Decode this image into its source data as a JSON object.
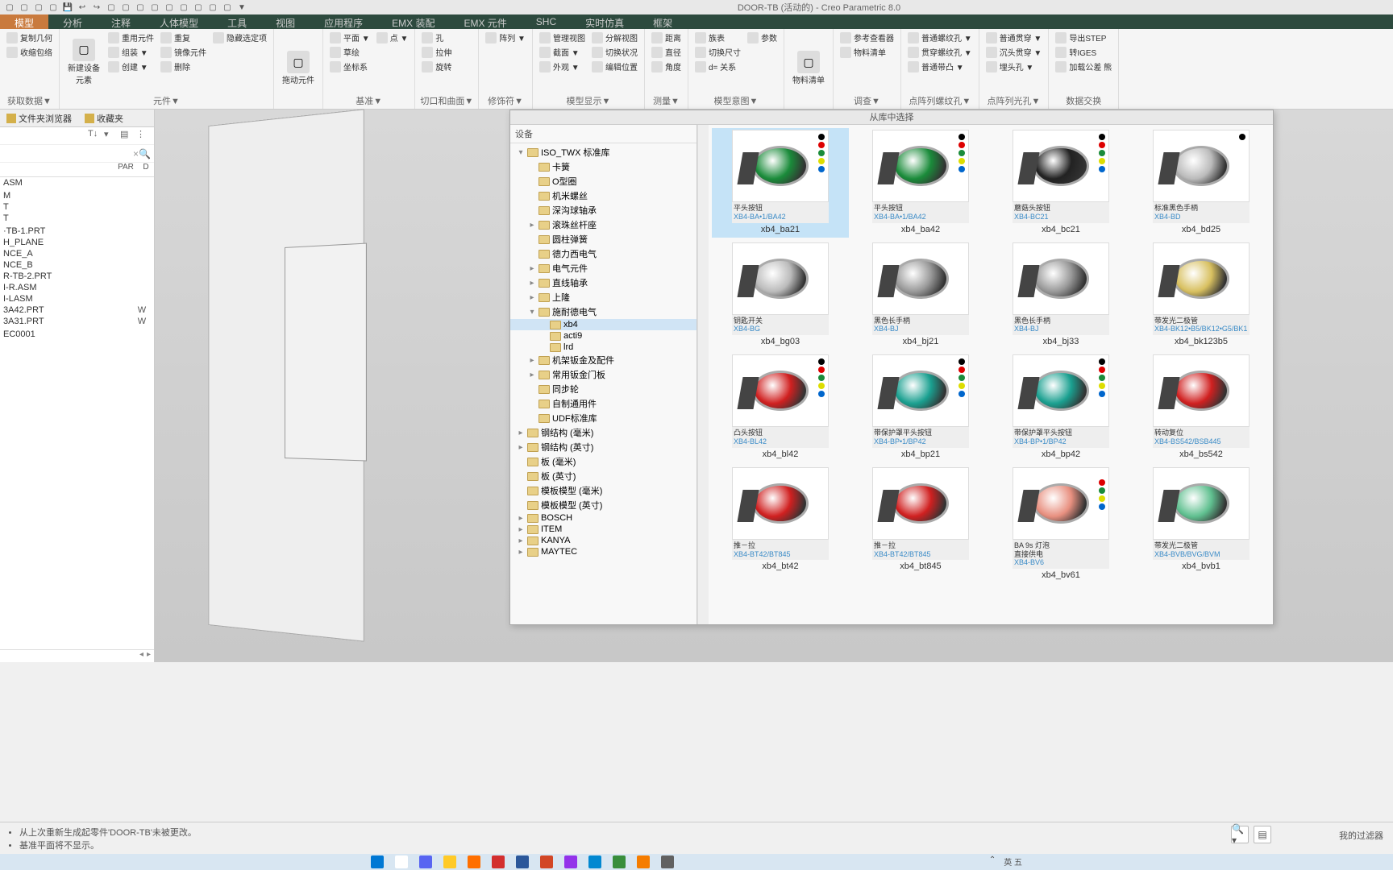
{
  "title": "DOOR-TB (活动的) - Creo Parametric 8.0",
  "tabs": [
    "模型",
    "分析",
    "注释",
    "人体模型",
    "工具",
    "视图",
    "应用程序",
    "EMX 装配",
    "EMX 元件",
    "SHC",
    "实时仿真",
    "框架"
  ],
  "activeTab": 0,
  "ribbon": {
    "groups": [
      {
        "label": "获取数据▼",
        "items": [
          {
            "t": "复制几何"
          },
          {
            "t": "收缩包络"
          }
        ]
      },
      {
        "label": "元件▼",
        "items": [
          {
            "t": "重用元件"
          },
          {
            "t": "组装 ▼"
          },
          {
            "t": "创建 ▼"
          },
          {
            "t": "重复"
          },
          {
            "t": "镜像元件"
          },
          {
            "t": "新建设备\n元素",
            "big": true
          },
          {
            "t": "删除"
          },
          {
            "t": "隐藏选定项"
          }
        ]
      },
      {
        "label": "",
        "items": [
          {
            "t": "拖动元件",
            "big": true
          }
        ]
      },
      {
        "label": "基准▼",
        "items": [
          {
            "t": "平面 ▼"
          },
          {
            "t": "草绘"
          },
          {
            "t": "坐标系"
          },
          {
            "t": "点 ▼"
          }
        ]
      },
      {
        "label": "切口和曲面▼",
        "items": [
          {
            "t": "孔"
          },
          {
            "t": "拉伸"
          },
          {
            "t": "旋转"
          }
        ]
      },
      {
        "label": "修饰符▼",
        "items": [
          {
            "t": "阵列 ▼"
          }
        ]
      },
      {
        "label": "模型显示▼",
        "items": [
          {
            "t": "管理视图"
          },
          {
            "t": "截面 ▼"
          },
          {
            "t": "外观 ▼"
          },
          {
            "t": "分解视图"
          },
          {
            "t": "切换状况"
          },
          {
            "t": "编辑位置"
          }
        ]
      },
      {
        "label": "测量▼",
        "items": [
          {
            "t": "距离"
          },
          {
            "t": "直径"
          },
          {
            "t": "角度"
          }
        ]
      },
      {
        "label": "模型意图▼",
        "items": [
          {
            "t": "族表"
          },
          {
            "t": "切换尺寸"
          },
          {
            "t": "d= 关系"
          },
          {
            "t": "参数"
          }
        ]
      },
      {
        "label": "",
        "items": [
          {
            "t": "物料清单",
            "big": true
          }
        ]
      },
      {
        "label": "调查▼",
        "items": [
          {
            "t": "参考查看器"
          },
          {
            "t": "物料清单"
          }
        ]
      },
      {
        "label": "点阵列螺纹孔▼",
        "items": [
          {
            "t": "普通螺纹孔 ▼"
          },
          {
            "t": "贯穿螺纹孔 ▼"
          },
          {
            "t": "普通带凸 ▼"
          }
        ]
      },
      {
        "label": "点阵列光孔▼",
        "items": [
          {
            "t": "普通贯穿 ▼"
          },
          {
            "t": "沉头贯穿 ▼"
          },
          {
            "t": "埋头孔 ▼"
          }
        ]
      },
      {
        "label": "数据交换",
        "items": [
          {
            "t": "导出STEP"
          },
          {
            "t": "转IGES"
          },
          {
            "t": "加载公差 熊"
          }
        ]
      }
    ]
  },
  "leftPanel": {
    "tabs": [
      "文件夹浏览器",
      "收藏夹"
    ],
    "headerCols": [
      "",
      "PAR",
      "D"
    ],
    "tree": [
      {
        "t": "ASM"
      },
      {
        "t": ""
      },
      {
        "t": "M"
      },
      {
        "t": "T"
      },
      {
        "t": "T"
      },
      {
        "t": ""
      },
      {
        "t": "·TB-1.PRT"
      },
      {
        "t": "H_PLANE"
      },
      {
        "t": "NCE_A"
      },
      {
        "t": "NCE_B"
      },
      {
        "t": "R-TB-2.PRT"
      },
      {
        "t": "I-R.ASM"
      },
      {
        "t": "I-LASM"
      },
      {
        "t": "3A42.PRT",
        "c2": "W"
      },
      {
        "t": "3A31.PRT",
        "c2": "W"
      },
      {
        "t": ""
      },
      {
        "t": "EC0001"
      }
    ]
  },
  "library": {
    "title": "从库中选择",
    "treeTitle": "设备",
    "tree": [
      {
        "t": "ISO_TWX 标准库",
        "d": 0,
        "e": "▾"
      },
      {
        "t": "卡簧",
        "d": 1
      },
      {
        "t": "O型圈",
        "d": 1
      },
      {
        "t": "机米螺丝",
        "d": 1
      },
      {
        "t": "深沟球轴承",
        "d": 1
      },
      {
        "t": "滚珠丝杆座",
        "d": 1,
        "e": "▸"
      },
      {
        "t": "圆柱弹簧",
        "d": 1
      },
      {
        "t": "德力西电气",
        "d": 1
      },
      {
        "t": "电气元件",
        "d": 1,
        "e": "▸"
      },
      {
        "t": "直线轴承",
        "d": 1,
        "e": "▸"
      },
      {
        "t": "上隆",
        "d": 1,
        "e": "▸"
      },
      {
        "t": "施耐德电气",
        "d": 1,
        "e": "▾"
      },
      {
        "t": "xb4",
        "d": 2,
        "sel": true
      },
      {
        "t": "acti9",
        "d": 2
      },
      {
        "t": "lrd",
        "d": 2
      },
      {
        "t": "机架钣金及配件",
        "d": 1,
        "e": "▸"
      },
      {
        "t": "常用钣金门板",
        "d": 1,
        "e": "▸"
      },
      {
        "t": "同步轮",
        "d": 1
      },
      {
        "t": "自制通用件",
        "d": 1
      },
      {
        "t": "UDF标准库",
        "d": 1
      },
      {
        "t": "钢结构 (毫米)",
        "d": 0,
        "e": "▸"
      },
      {
        "t": "钢结构 (英寸)",
        "d": 0,
        "e": "▸"
      },
      {
        "t": "板 (毫米)",
        "d": 0
      },
      {
        "t": "板 (英寸)",
        "d": 0
      },
      {
        "t": "模板模型 (毫米)",
        "d": 0
      },
      {
        "t": "模板模型 (英寸)",
        "d": 0
      },
      {
        "t": "BOSCH",
        "d": 0,
        "e": "▸"
      },
      {
        "t": "ITEM",
        "d": 0,
        "e": "▸"
      },
      {
        "t": "KANYA",
        "d": 0,
        "e": "▸"
      },
      {
        "t": "MAYTEC",
        "d": 0,
        "e": "▸"
      }
    ],
    "items": [
      {
        "name": "xb4_ba21",
        "m1": "平头按钮",
        "m2": "XB4-BA•1/BA42",
        "c": "#1a8b3a",
        "dots": [
          "#000",
          "#d00",
          "#1a8b3a",
          "#dd0",
          "#06c"
        ],
        "sel": true
      },
      {
        "name": "xb4_ba42",
        "m1": "平头按钮",
        "m2": "XB4-BA•1/BA42",
        "c": "#1a8b3a",
        "dots": [
          "#000",
          "#d00",
          "#1a8b3a",
          "#dd0",
          "#06c"
        ]
      },
      {
        "name": "xb4_bc21",
        "m1": "蘑菇头按钮",
        "m2": "XB4-BC21",
        "c": "#222",
        "dots": [
          "#000",
          "#d00",
          "#1a8b3a",
          "#dd0",
          "#06c"
        ]
      },
      {
        "name": "xb4_bd25",
        "m1": "标准黑色手柄",
        "m2": "XB4-BD",
        "c": "#bbb",
        "dots": [
          "#000"
        ]
      },
      {
        "name": "xb4_bg03",
        "m1": "钥匙开关",
        "m2": "XB4-BG",
        "c": "#bbb"
      },
      {
        "name": "xb4_bj21",
        "m1": "黑色长手柄",
        "m2": "XB4-BJ",
        "c": "#999"
      },
      {
        "name": "xb4_bj33",
        "m1": "黑色长手柄",
        "m2": "XB4-BJ",
        "c": "#999"
      },
      {
        "name": "xb4_bk123b5",
        "m1": "带发光二极管",
        "m2": "XB4-BK12•B5/BK12•G5/BK1",
        "c": "#d8c060"
      },
      {
        "name": "xb4_bl42",
        "m1": "凸头按钮",
        "m2": "XB4-BL42",
        "c": "#d02020",
        "dots": [
          "#000",
          "#d00",
          "#1a8b3a",
          "#dd0",
          "#06c"
        ]
      },
      {
        "name": "xb4_bp21",
        "m1": "带保护罩平头按钮",
        "m2": "XB4-BP•1/BP42",
        "c": "#1aa090",
        "dots": [
          "#000",
          "#d00",
          "#1a8b3a",
          "#dd0",
          "#06c"
        ]
      },
      {
        "name": "xb4_bp42",
        "m1": "带保护罩平头按钮",
        "m2": "XB4-BP•1/BP42",
        "c": "#1aa090",
        "dots": [
          "#000",
          "#d00",
          "#1a8b3a",
          "#dd0",
          "#06c"
        ]
      },
      {
        "name": "xb4_bs542",
        "m1": "转动复位",
        "m2": "XB4-BS542/BSB445",
        "c": "#d02020"
      },
      {
        "name": "xb4_bt42",
        "m1": "推－拉",
        "m2": "XB4-BT42/BT845",
        "c": "#d02020"
      },
      {
        "name": "xb4_bt845",
        "m1": "推－拉",
        "m2": "XB4-BT42/BT845",
        "c": "#d02020"
      },
      {
        "name": "xb4_bv61",
        "m1": "BA 9s 灯泡\n直接供电",
        "m2": "XB4-BV6",
        "c": "#e89080",
        "dots": [
          "#fff",
          "#d00",
          "#1a8b3a",
          "#dd0",
          "#06c"
        ]
      },
      {
        "name": "xb4_bvb1",
        "m1": "带发光二极管",
        "m2": "XB4-BVB/BVG/BVM",
        "c": "#60c090"
      }
    ]
  },
  "status": {
    "lines": [
      "从上次重新生成起零件'DOOR-TB'未被更改。",
      "基准平面将不显示。"
    ],
    "filter": "我的过滤器"
  },
  "taskbar": {
    "lang": "英 五",
    "time": ""
  }
}
